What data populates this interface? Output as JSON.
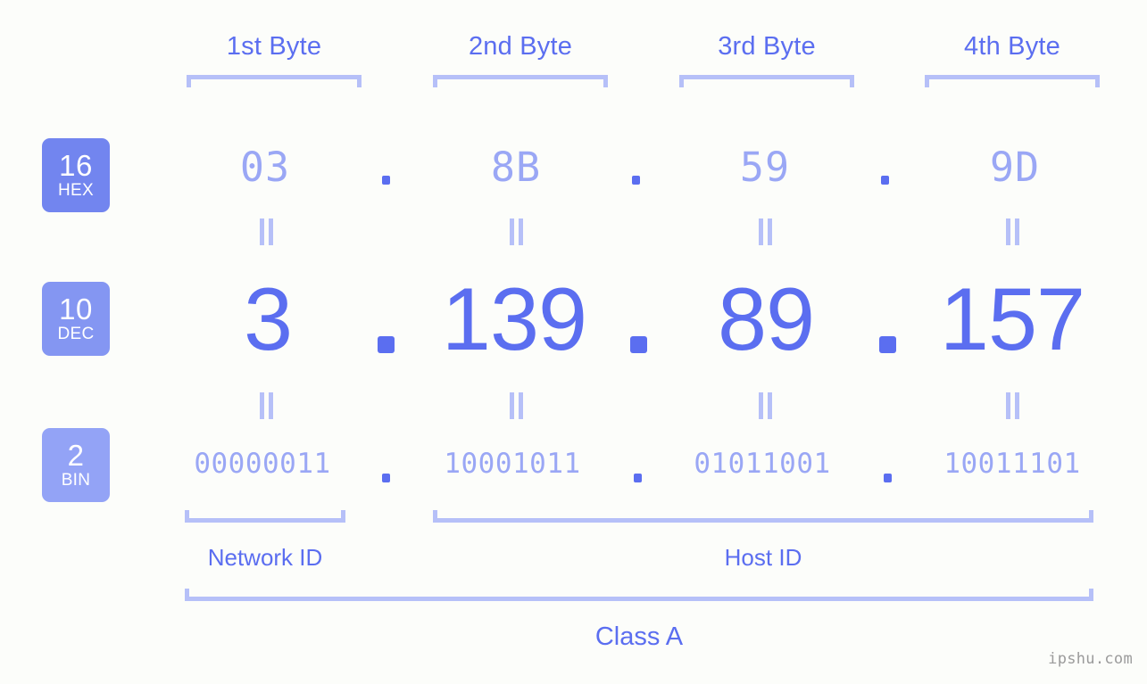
{
  "background_color": "#fcfdfa",
  "accent_color": "#5b6ef0",
  "muted_accent_color": "#9aa7f5",
  "rule_color": "#b6c0f8",
  "watermark": "ipshu.com",
  "byte_headers": [
    {
      "label": "1st Byte"
    },
    {
      "label": "2nd Byte"
    },
    {
      "label": "3rd Byte"
    },
    {
      "label": "4th Byte"
    }
  ],
  "rows": [
    {
      "id": "hex",
      "badge_number": "16",
      "badge_system": "HEX",
      "badge_color": "#7285ef",
      "values": [
        "03",
        "8B",
        "59",
        "9D"
      ],
      "separator": "."
    },
    {
      "id": "dec",
      "badge_number": "10",
      "badge_system": "DEC",
      "badge_color": "#8496f2",
      "values": [
        "3",
        "139",
        "89",
        "157"
      ],
      "separator": "."
    },
    {
      "id": "bin",
      "badge_number": "2",
      "badge_system": "BIN",
      "badge_color": "#93a3f6",
      "values": [
        "00000011",
        "10001011",
        "01011001",
        "10011101"
      ],
      "separator": "."
    }
  ],
  "equality_marks": {
    "symbol": "=",
    "count_per_gap": 4,
    "gaps": 2
  },
  "segments": {
    "network_id": "Network ID",
    "host_id": "Host ID"
  },
  "class": {
    "label": "Class A"
  }
}
